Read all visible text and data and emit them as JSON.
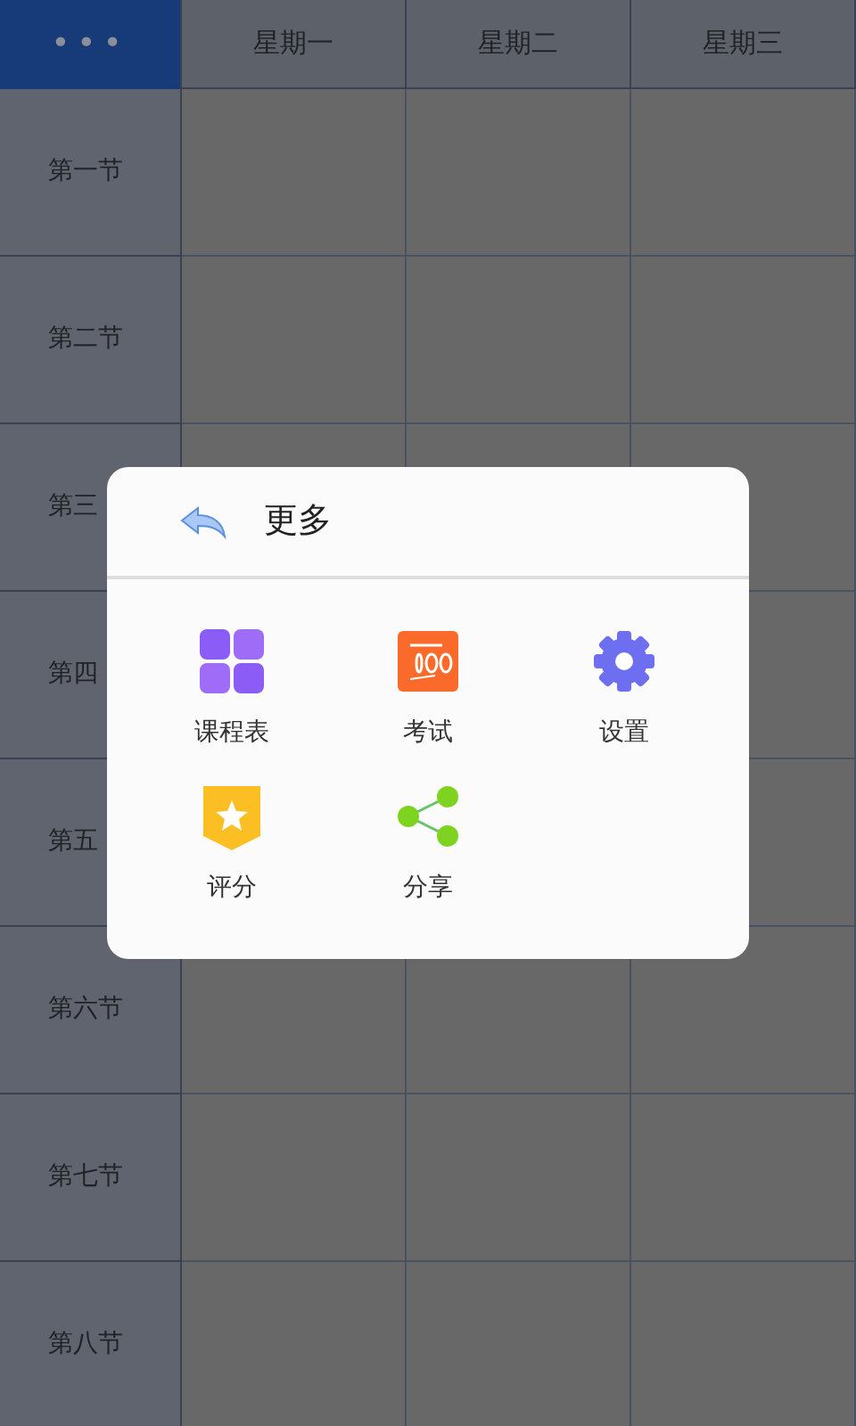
{
  "timetable": {
    "corner_button": "•••",
    "days": [
      "星期一",
      "星期二",
      "星期三"
    ],
    "periods": [
      "第一节",
      "第二节",
      "第三",
      "第四",
      "第五",
      "第六节",
      "第七节",
      "第八节"
    ]
  },
  "dialog": {
    "title": "更多",
    "items": [
      {
        "label": "课程表"
      },
      {
        "label": "考试"
      },
      {
        "label": "设置"
      },
      {
        "label": "评分"
      },
      {
        "label": "分享"
      }
    ]
  }
}
